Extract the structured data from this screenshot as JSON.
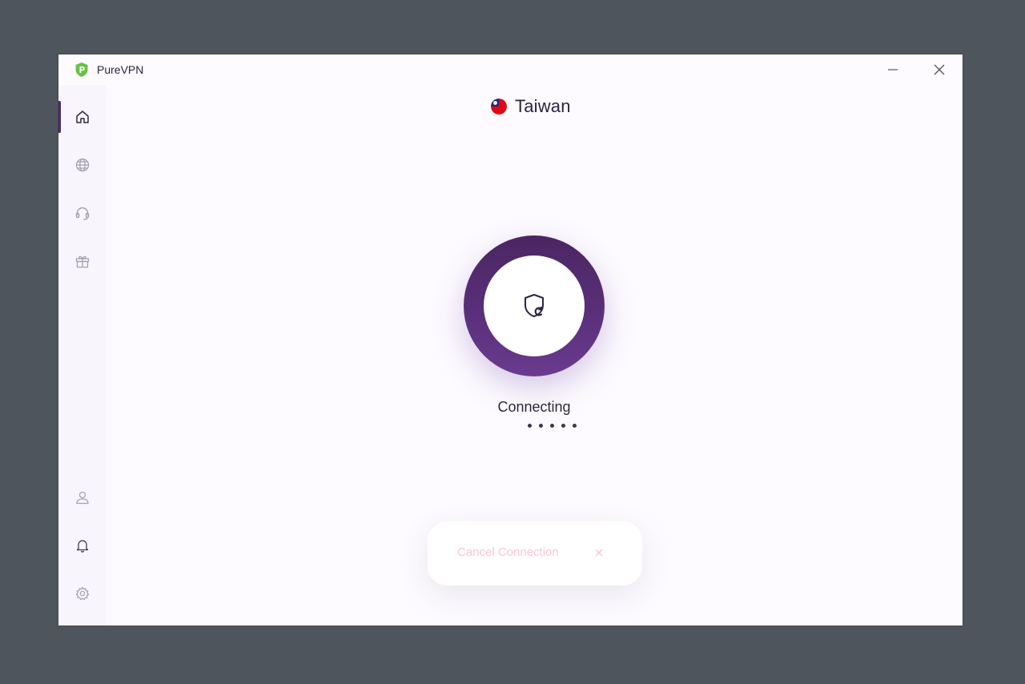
{
  "app": {
    "title": "PureVPN"
  },
  "location": {
    "name": "Taiwan",
    "flag_icon": "taiwan-flag"
  },
  "connection": {
    "status": "Connecting",
    "cancel_label": "Cancel Connection"
  },
  "sidebar": {
    "top_items": [
      {
        "name": "home",
        "icon": "home-icon",
        "active": true
      },
      {
        "name": "locations",
        "icon": "globe-icon",
        "active": false
      },
      {
        "name": "support",
        "icon": "headset-icon",
        "active": false
      },
      {
        "name": "rewards",
        "icon": "gift-icon",
        "active": false
      }
    ],
    "bottom_items": [
      {
        "name": "account",
        "icon": "user-icon"
      },
      {
        "name": "notifications",
        "icon": "bell-icon"
      },
      {
        "name": "settings",
        "icon": "gear-icon"
      }
    ]
  },
  "colors": {
    "brand_purple": "#5a2f7a",
    "ring_top": "#4b2662",
    "ring_bottom": "#6a3b8f",
    "logo_green": "#6ac043",
    "cancel_text": "#f6c6d6",
    "background": "#fdfbff"
  }
}
